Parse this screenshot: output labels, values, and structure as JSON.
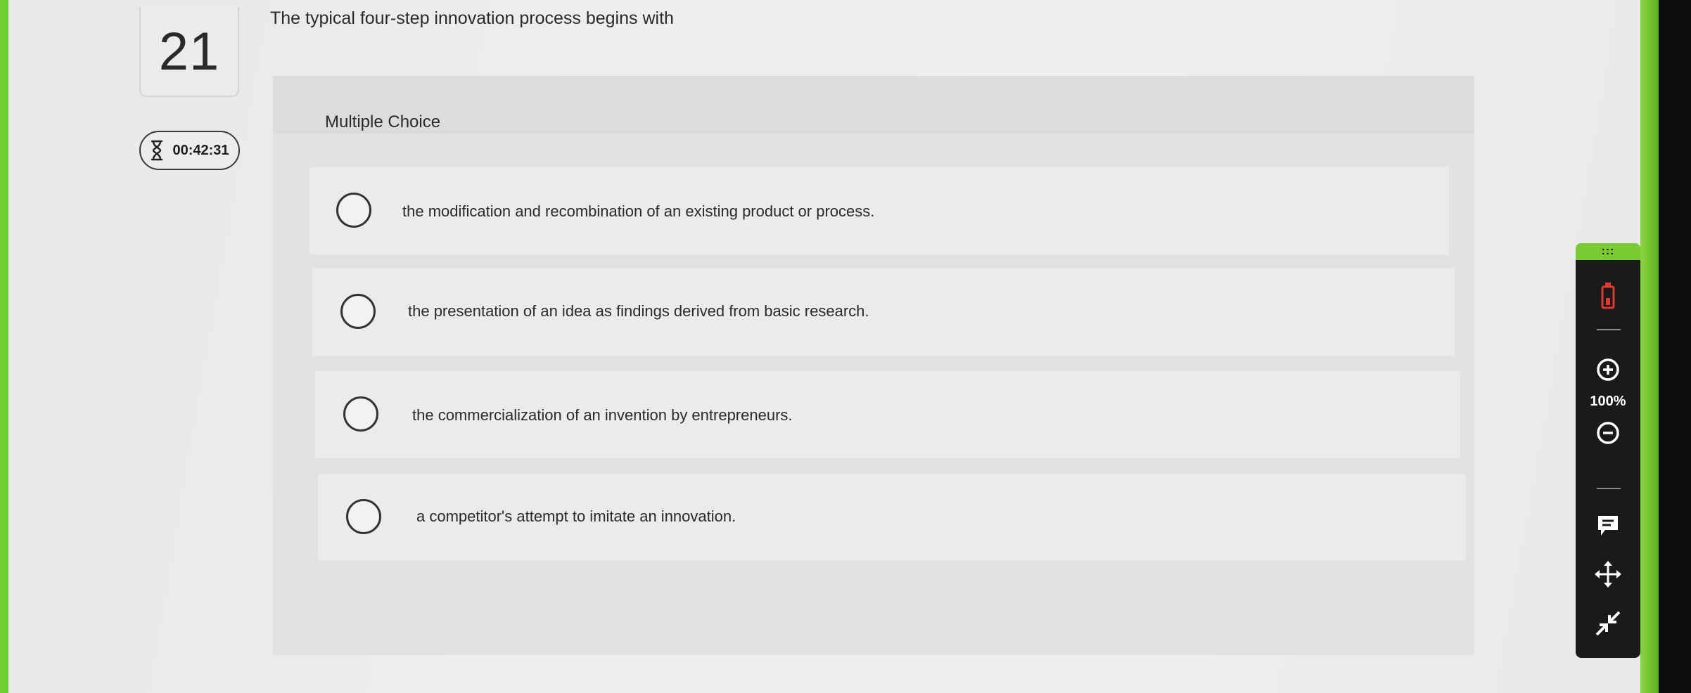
{
  "question": {
    "number": "21",
    "text": "The typical four-step innovation process begins with",
    "timer": "00:42:31"
  },
  "panel": {
    "type_label": "Multiple Choice",
    "choices": [
      {
        "text": "the modification and recombination of an existing product or process."
      },
      {
        "text": "the presentation of an idea as findings derived from basic research."
      },
      {
        "text": "the commercialization of an invention by entrepreneurs."
      },
      {
        "text": "a competitor's attempt to imitate an innovation."
      }
    ]
  },
  "toolbar": {
    "grip": ":::",
    "zoom_level": "100%",
    "icons": [
      "highlighter-icon",
      "zoom-in-icon",
      "zoom-out-icon",
      "comment-icon",
      "move-icon",
      "collapse-icon"
    ],
    "accent": "#7acb33"
  },
  "colors": {
    "frame_green": "#6fcf2e",
    "toolbar_bg": "#1a1a1a"
  }
}
